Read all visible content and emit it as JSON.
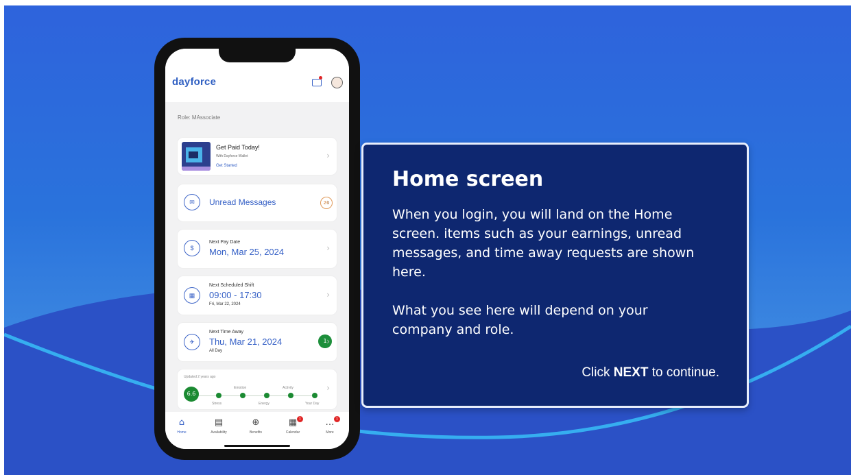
{
  "app": {
    "logo": "dayforce",
    "role": "Role: MAssociate"
  },
  "cards": {
    "paid": {
      "title": "Get Paid Today!",
      "subtitle": "With Dayforce Wallet",
      "link": "Get Started"
    },
    "messages": {
      "label": "Unread Messages",
      "count": "26"
    },
    "pay": {
      "label": "Next Pay Date",
      "value": "Mon, Mar 25, 2024"
    },
    "shift": {
      "label": "Next Scheduled Shift",
      "value": "09:00 - 17:30",
      "sub": "Fri, Mar 22, 2024"
    },
    "timeaway": {
      "label": "Next Time Away",
      "value": "Thu, Mar 21, 2024",
      "sub": "All Day",
      "count": "1"
    },
    "wellbeing": {
      "updated": "Updated 2 years ago",
      "score": "6.6",
      "top_labels": [
        "Emotion",
        "Activity"
      ],
      "bottom_labels": [
        "Stress",
        "Energy",
        "Your Day"
      ]
    }
  },
  "tabs": [
    {
      "label": "Home",
      "icon": "home-icon"
    },
    {
      "label": "Availability",
      "icon": "availability-icon"
    },
    {
      "label": "Benefits",
      "icon": "benefits-icon"
    },
    {
      "label": "Calendar",
      "icon": "calendar-icon",
      "badge": "1"
    },
    {
      "label": "More",
      "icon": "more-icon",
      "badge": "1"
    }
  ],
  "panel": {
    "title": "Home screen",
    "paragraph1": "When you login, you will land on the Home screen. items such as your earnings, unread messages, and time away requests are shown here.",
    "paragraph2": "What you see here will depend on your company and role.",
    "cta_prefix": "Click ",
    "cta_bold": "NEXT",
    "cta_suffix": " to continue."
  },
  "colors": {
    "background": "#2e63dc",
    "panel": "#0e2770",
    "accent": "#3560c6",
    "green": "#1d8f3b"
  }
}
